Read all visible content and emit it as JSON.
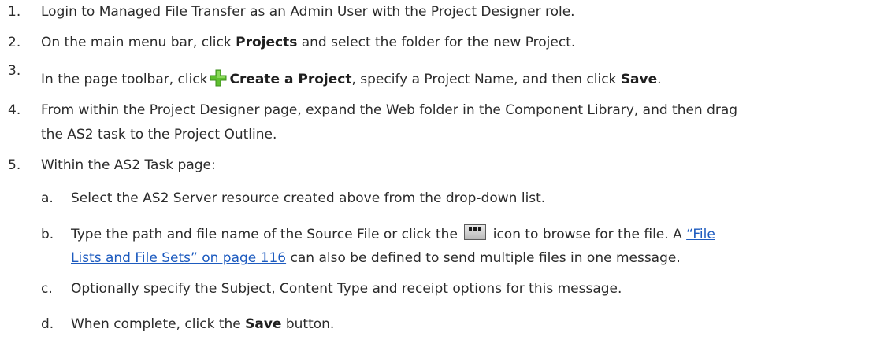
{
  "steps": [
    {
      "num": "1.",
      "text": "Login to Managed File Transfer as an Admin User with the Project Designer role."
    },
    {
      "num": "2.",
      "pre": "On the main menu bar, click ",
      "bold": "Projects",
      "post": " and select the folder for the new Project."
    },
    {
      "num": "3.",
      "pre": "In the page toolbar, click",
      "bold1": "Create a Project",
      "mid": ", specify a Project Name, and then click ",
      "bold2": "Save",
      "post": ".",
      "icon": "add-plus-icon"
    },
    {
      "num": "4.",
      "line1": "From within the Project Designer page, expand the Web folder in the Component Library, and then drag",
      "line2": "the AS2 task to the Project Outline."
    },
    {
      "num": "5.",
      "text": "Within the AS2 Task page:"
    }
  ],
  "substeps": [
    {
      "letter": "a.",
      "text": "Select the AS2 Server resource created above from the drop-down list."
    },
    {
      "letter": "b.",
      "pre": "Type the path and file name of the Source File or click the",
      "post": "icon to browse for the file. A",
      "link1": "“File",
      "link2": "Lists and File Sets” on page 116",
      "line2_post": " can also be defined to send multiple files in one message.",
      "icon": "browse-icon"
    },
    {
      "letter": "c.",
      "text": "Optionally specify the Subject, Content Type and receipt options for this message."
    },
    {
      "letter": "d.",
      "pre": "When complete, click the ",
      "bold": "Save",
      "post": " button."
    }
  ],
  "colors": {
    "link": "#1d5bbf",
    "plus": "#5fbf2f"
  }
}
